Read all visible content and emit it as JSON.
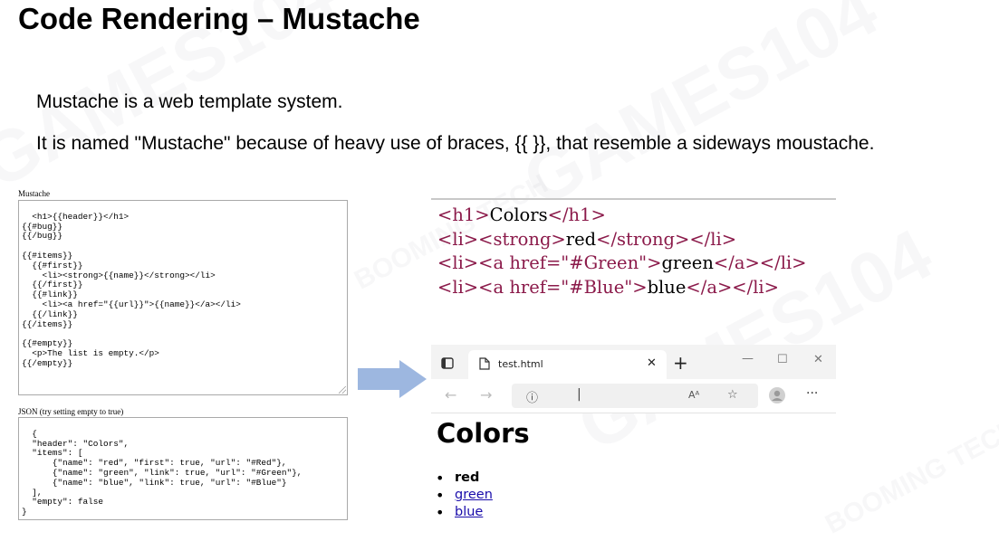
{
  "slide": {
    "title": "Code Rendering – Mustache",
    "bullets": [
      "Mustache is a web template system.",
      "It is named \"Mustache\" because of heavy use of braces, {{ }}, that resemble a sideways moustache."
    ]
  },
  "editor": {
    "template_label": "Mustache",
    "template_text": "<h1>{{header}}</h1>\n{{#bug}}\n{{/bug}}\n\n{{#items}}\n  {{#first}}\n    <li><strong>{{name}}</strong></li>\n  {{/first}}\n  {{#link}}\n    <li><a href=\"{{url}}\">{{name}}</a></li>\n  {{/link}}\n{{/items}}\n\n{{#empty}}\n  <p>The list is empty.</p>\n{{/empty}}",
    "json_label": "JSON (try setting empty to true)",
    "json_text": "{\n  \"header\": \"Colors\",\n  \"items\": [\n      {\"name\": \"red\", \"first\": true, \"url\": \"#Red\"},\n      {\"name\": \"green\", \"link\": true, \"url\": \"#Green\"},\n      {\"name\": \"blue\", \"link\": true, \"url\": \"#Blue\"}\n  ],\n  \"empty\": false\n}"
  },
  "html_output": {
    "lines": [
      [
        "<h1>",
        "Colors",
        "</h1>"
      ],
      [
        "<li><strong>",
        "red",
        "</strong></li>"
      ],
      [
        "<li><a href=\"#Green\">",
        "green",
        "</a></li>"
      ],
      [
        "<li><a href=\"#Blue\">",
        "blue",
        "</a></li>"
      ]
    ]
  },
  "browser": {
    "tab_title": "test.html",
    "icons": [
      "sidebar-toggle-icon",
      "page-icon",
      "close-tab-icon",
      "new-tab-icon",
      "minimize-icon",
      "maximize-icon",
      "close-window-icon",
      "back-icon",
      "forward-icon",
      "info-icon",
      "read-aloud-icon",
      "add-favorite-icon",
      "profile-icon",
      "more-icon"
    ],
    "page": {
      "heading": "Colors",
      "items": [
        {
          "label": "red"
        },
        {
          "label": "green"
        },
        {
          "label": "blue"
        }
      ]
    }
  },
  "watermarks": [
    "GAMES104",
    "BOOMING TECH"
  ],
  "colors": {
    "arrow": "#9db7e0",
    "tag": "#8b1a4a",
    "attr": "#1a1aa6",
    "link": "#1a0dab"
  }
}
